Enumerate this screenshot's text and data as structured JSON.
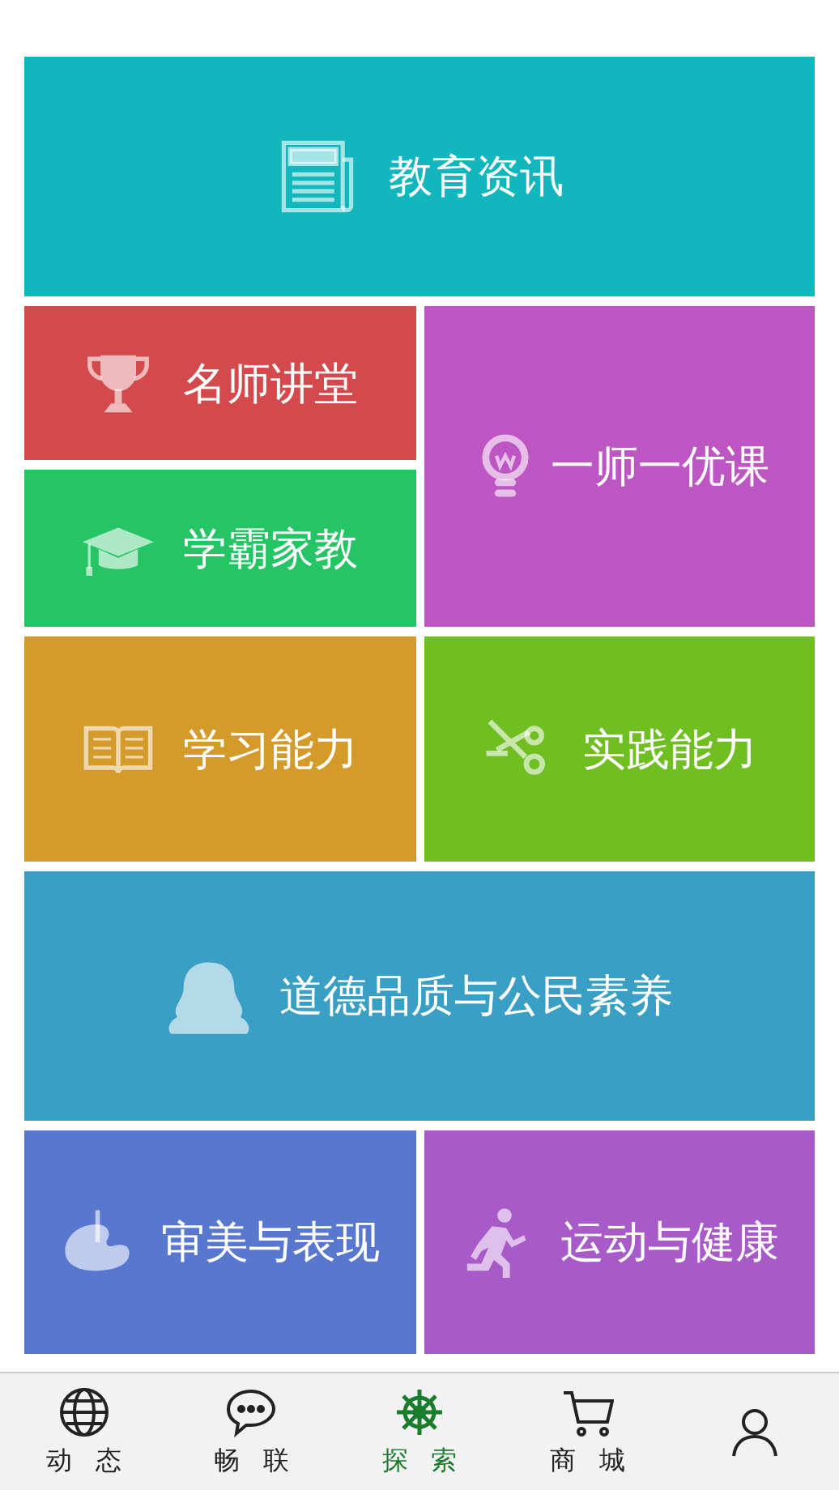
{
  "tiles": [
    {
      "label": "教育资讯",
      "color": "#12b6bd"
    },
    {
      "label": "名师讲堂",
      "color": "#d44a4c"
    },
    {
      "label": "一师一优课",
      "color": "#bd55c2"
    },
    {
      "label": "学霸家教",
      "color": "#25c465"
    },
    {
      "label": "学习能力",
      "color": "#d49a2a"
    },
    {
      "label": "实践能力",
      "color": "#6fbe22"
    },
    {
      "label": "道德品质与公民素养",
      "color": "#3a9fc5"
    },
    {
      "label": "审美与表现",
      "color": "#5878cf"
    },
    {
      "label": "运动与健康",
      "color": "#a85ac8"
    }
  ],
  "nav": [
    {
      "label": "动态",
      "selected": false
    },
    {
      "label": "畅联",
      "selected": false
    },
    {
      "label": "探索",
      "selected": true
    },
    {
      "label": "商城",
      "selected": false
    },
    {
      "selected": false
    }
  ]
}
